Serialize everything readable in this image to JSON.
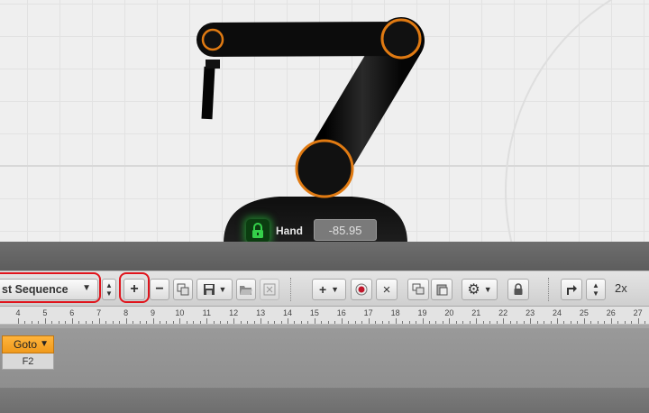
{
  "viewport": {
    "hand_label": "Hand",
    "hand_value": "-85.95",
    "lock_icon": "lock-icon",
    "colors": {
      "joint_ring": "#e07a12",
      "lock_glow": "#2fc043",
      "arm": "#111111"
    }
  },
  "toolbar": {
    "sequence_select": "st Sequence",
    "add_label": "+",
    "remove_label": "−",
    "add_step_label": "+",
    "stop_label": "×",
    "speed_label": "2x"
  },
  "ruler": {
    "ticks": [
      "4",
      "5",
      "6",
      "7",
      "8",
      "9",
      "10",
      "11",
      "12",
      "13",
      "14",
      "15",
      "16",
      "17",
      "18",
      "19",
      "20",
      "21",
      "22",
      "23",
      "24",
      "25",
      "26",
      "27"
    ]
  },
  "timeline": {
    "block_label": "Goto",
    "block_arg": "F2",
    "colors": {
      "block": "#f5a623"
    }
  },
  "highlights": {
    "color": "#e0141c"
  }
}
